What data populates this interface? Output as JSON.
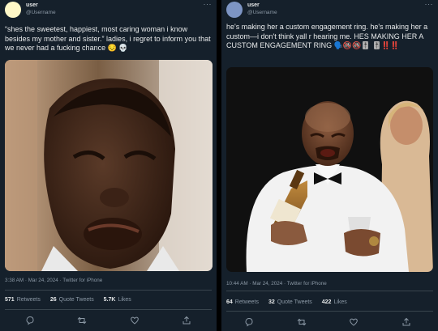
{
  "left_tweet": {
    "username": "user",
    "handle": "@Username",
    "more": "···",
    "text": "“shes the sweetest, happiest, most caring woman i know besides my mother and sister.” ladies, i regret to inform you that we never had a fucking chance 😔 💀",
    "timestamp": "3:38 AM · Mar 24, 2024 · Twitter for iPhone",
    "stats": {
      "retweets_count": "571",
      "retweets_label": "Retweets",
      "quotes_count": "26",
      "quotes_label": "Quote Tweets",
      "likes_count": "5.7K",
      "likes_label": "Likes"
    }
  },
  "right_tweet": {
    "username": "user",
    "handle": "@Username",
    "more": "···",
    "text": "he's making her a custom engagement ring. he's making her a custom—i don't think yall r hearing me. HES MAKING HER A CUSTOM ENGAGEMENT RING 🗣️🚳🚳🎚️ 🎚️‼️‼️",
    "timestamp": "10:44 AM · Mar 24, 2024 · Twitter for iPhone",
    "stats": {
      "retweets_count": "64",
      "retweets_label": "Retweets",
      "quotes_count": "32",
      "quotes_label": "Quote Tweets",
      "likes_count": "422",
      "likes_label": "Likes"
    }
  },
  "colors": {
    "background": "#15202b",
    "text_primary": "#e7e9ea",
    "text_secondary": "#8b98a5",
    "divider": "#38444d",
    "left_avatar": "#fff8c8",
    "right_avatar": "#7d95c4"
  },
  "icons": [
    "reply-icon",
    "retweet-icon",
    "like-icon",
    "share-icon"
  ]
}
